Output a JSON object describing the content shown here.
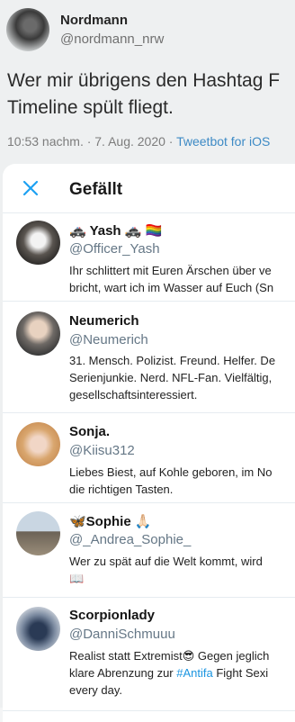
{
  "tweet": {
    "author_name": "Nordmann",
    "author_handle": "@nordmann_nrw",
    "text_line1": "Wer mir übrigens den Hashtag F",
    "text_line2": "Timeline spült fliegt.",
    "time": "10:53 nachm. · 7. Aug. 2020 · ",
    "source": "Tweetbot for iOS"
  },
  "modal": {
    "title": "Gefällt",
    "close_icon": "close-icon",
    "accent": "#1da1f2"
  },
  "users": [
    {
      "name": "🚓 Yash 🚓 🏳️‍🌈",
      "handle": "@Officer_Yash",
      "bio": [
        "Ihr schlittert mit Euren Ärschen über ve",
        "bricht, wart ich im Wasser auf Euch (Sn"
      ]
    },
    {
      "name": "Neumerich",
      "handle": "@Neumerich",
      "bio": [
        "31. Mensch. Polizist. Freund. Helfer. De",
        "Serienjunkie. Nerd. NFL-Fan. Vielfältig,",
        "gesellschaftsinteressiert."
      ]
    },
    {
      "name": "Sonja.",
      "handle": "@Kiisu312",
      "bio": [
        "Liebes Biest, auf Kohle geboren, im No",
        "die richtigen Tasten."
      ]
    },
    {
      "name": "🦋Sophie 🙏🏻",
      "handle": "@_Andrea_Sophie_",
      "bio": [
        "Wer zu spät auf die Welt kommt, wird",
        "📖"
      ]
    },
    {
      "name": "Scorpionlady",
      "handle": "@DanniSchmuuu",
      "bio_pre": "Realist statt Extremist😎 Gegen jeglich",
      "bio_line2_pre": "klare Abrenzung zur ",
      "bio_hashtag": "#Antifa",
      "bio_line2_post": " Fight Sexi",
      "bio_line3": "every day."
    }
  ]
}
